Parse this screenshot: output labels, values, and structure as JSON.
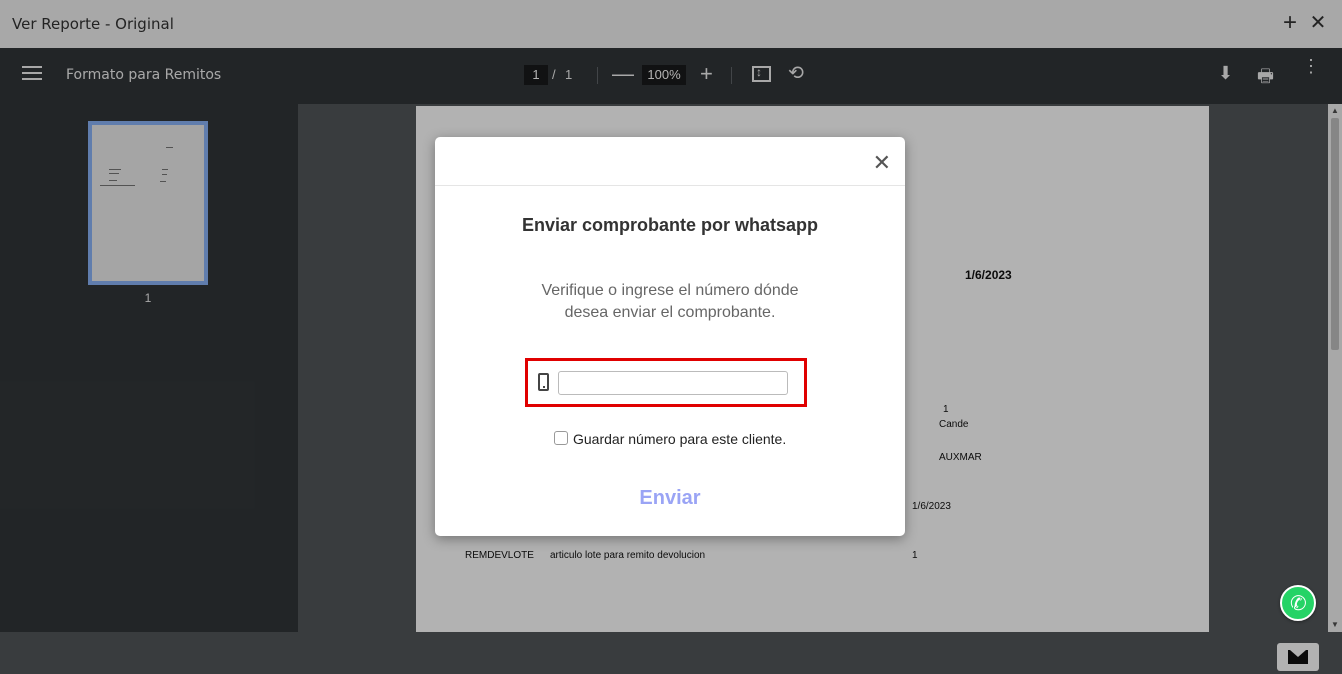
{
  "window": {
    "title": "Ver Reporte - Original",
    "add_icon": "+",
    "close_icon": "✕"
  },
  "toolbar": {
    "doc_title": "Formato para Remitos",
    "current_page": "1",
    "page_sep": "/",
    "total_pages": "1",
    "zoom_minus": "—",
    "zoom": "100%",
    "zoom_plus": "+",
    "rotate_icon": "⟲",
    "download_icon": "⬇",
    "print_icon": "🖶",
    "more_icon": "⋮"
  },
  "sidebar": {
    "thumb_number": "1"
  },
  "document": {
    "date_top": "1/6/2023",
    "field_1": "1",
    "field_cande": "Cande",
    "field_auxmar": "AUXMAR",
    "field_date": "1/6/2023",
    "row_code": "REMDEVLOTE",
    "row_desc": "articulo lote para remito devolucion",
    "row_qty": "1"
  },
  "modal": {
    "close_icon": "✕",
    "title": "Enviar comprobante por whatsapp",
    "description": "Verifique o ingrese el número dónde desea enviar el comprobante.",
    "phone_value": "",
    "save_label": "Guardar número para este cliente.",
    "send_label": "Enviar"
  },
  "colors": {
    "accent_send": "#9aa4f5",
    "highlight_border": "#e00000",
    "whatsapp": "#25d366"
  }
}
